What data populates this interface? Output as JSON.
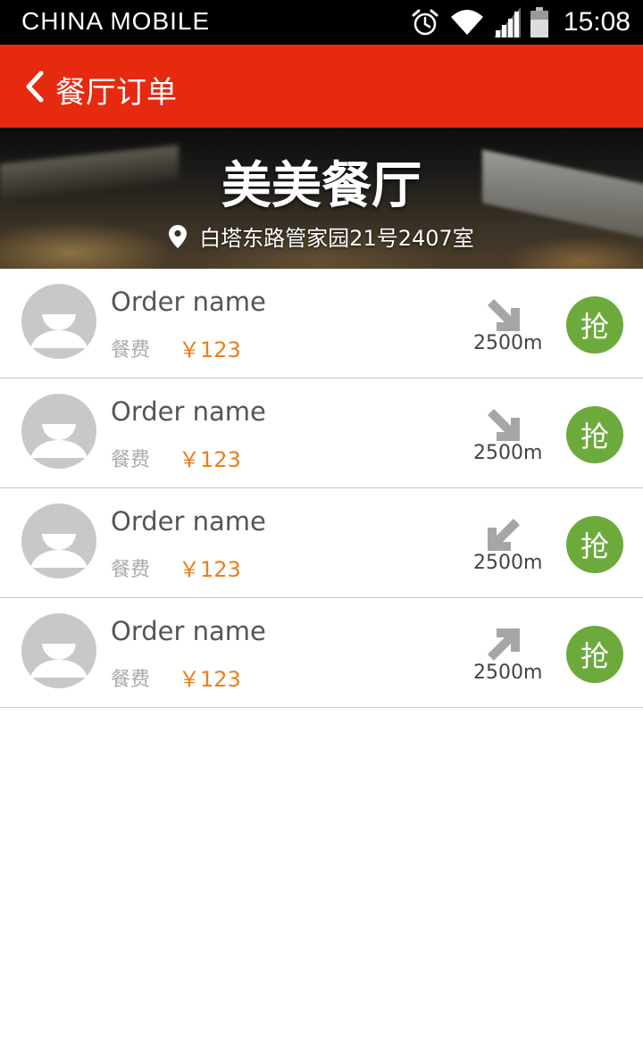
{
  "status_bar": {
    "carrier": "CHINA  MOBILE",
    "time": "15:08",
    "icons": [
      "alarm-icon",
      "wifi-icon",
      "signal-icon",
      "battery-icon"
    ]
  },
  "app_bar": {
    "title": "餐厅订单",
    "back_icon": "chevron-left-icon",
    "background": "#e62a10"
  },
  "restaurant": {
    "name": "美美餐厅",
    "address": "白塔东路管家园21号2407室",
    "location_icon": "map-pin-icon"
  },
  "orders": [
    {
      "name": "Order name",
      "fee_label": "餐费",
      "fee": "￥123",
      "direction": "down-right",
      "distance": "2500m",
      "action": "抢"
    },
    {
      "name": "Order name",
      "fee_label": "餐费",
      "fee": "￥123",
      "direction": "down-right",
      "distance": "2500m",
      "action": "抢"
    },
    {
      "name": "Order name",
      "fee_label": "餐费",
      "fee": "￥123",
      "direction": "down-left",
      "distance": "2500m",
      "action": "抢"
    },
    {
      "name": "Order name",
      "fee_label": "餐费",
      "fee": "￥123",
      "direction": "up-right",
      "distance": "2500m",
      "action": "抢"
    }
  ],
  "colors": {
    "accent": "#e62a10",
    "price": "#ef7d1a",
    "grab_button": "#6caa3c",
    "avatar": "#c9c8c9"
  }
}
